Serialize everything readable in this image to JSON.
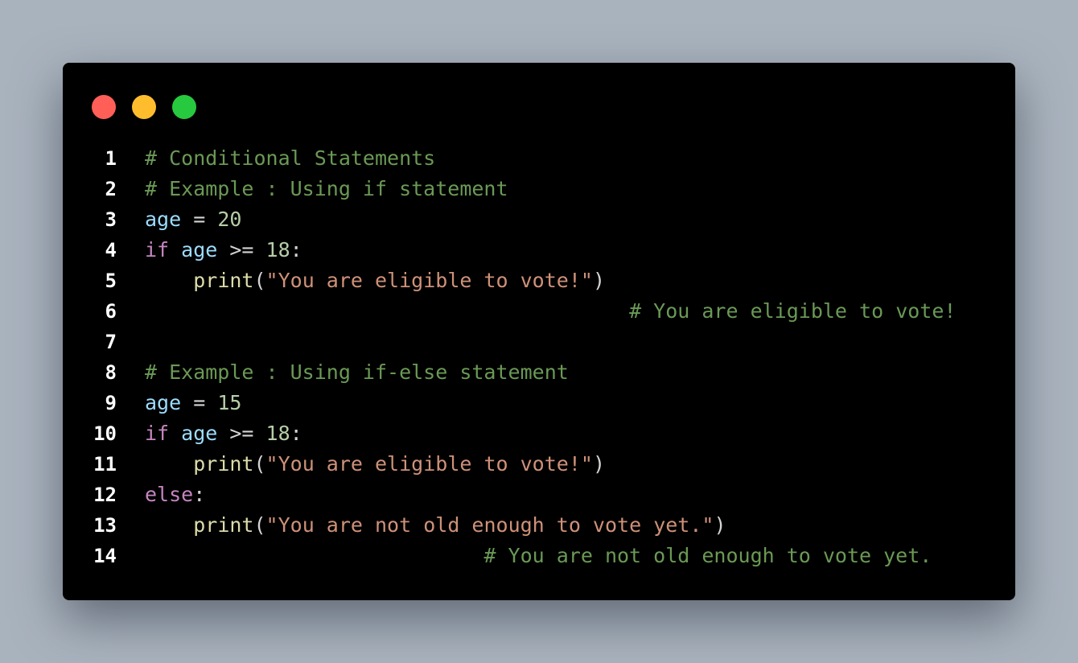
{
  "colors": {
    "background": "#a9b3be",
    "window": "#000000",
    "dot_red": "#ff5f56",
    "dot_yellow": "#ffbd2e",
    "dot_green": "#27c93f",
    "line_number": "#ffffff",
    "comment": "#6a9955",
    "variable": "#9cdcfe",
    "number": "#b5cea8",
    "keyword": "#c586c0",
    "function": "#dcdcaa",
    "string": "#ce9178",
    "operator": "#d4d4d4"
  },
  "window_controls": [
    {
      "name": "close-dot",
      "color": "#ff5f56"
    },
    {
      "name": "minimize-dot",
      "color": "#ffbd2e"
    },
    {
      "name": "maximize-dot",
      "color": "#27c93f"
    }
  ],
  "lines": [
    {
      "number": "1",
      "tokens": [
        {
          "t": "comment",
          "v": "# Conditional Statements"
        }
      ]
    },
    {
      "number": "2",
      "tokens": [
        {
          "t": "comment",
          "v": "# Example : Using if statement"
        }
      ]
    },
    {
      "number": "3",
      "tokens": [
        {
          "t": "var",
          "v": "age"
        },
        {
          "t": "op",
          "v": " = "
        },
        {
          "t": "num",
          "v": "20"
        }
      ]
    },
    {
      "number": "4",
      "tokens": [
        {
          "t": "kw",
          "v": "if"
        },
        {
          "t": "op",
          "v": " "
        },
        {
          "t": "var",
          "v": "age"
        },
        {
          "t": "op",
          "v": " >= "
        },
        {
          "t": "num",
          "v": "18"
        },
        {
          "t": "punc",
          "v": ":"
        }
      ]
    },
    {
      "number": "5",
      "tokens": [
        {
          "t": "op",
          "v": "    "
        },
        {
          "t": "fn",
          "v": "print"
        },
        {
          "t": "punc",
          "v": "("
        },
        {
          "t": "str",
          "v": "\"You are eligible to vote!\""
        },
        {
          "t": "punc",
          "v": ")"
        }
      ]
    },
    {
      "number": "6",
      "tokens": [
        {
          "t": "op",
          "v": "                                        "
        },
        {
          "t": "comment",
          "v": "# You are eligible to vote!"
        }
      ]
    },
    {
      "number": "7",
      "tokens": []
    },
    {
      "number": "8",
      "tokens": [
        {
          "t": "comment",
          "v": "# Example : Using if-else statement"
        }
      ]
    },
    {
      "number": "9",
      "tokens": [
        {
          "t": "var",
          "v": "age"
        },
        {
          "t": "op",
          "v": " = "
        },
        {
          "t": "num",
          "v": "15"
        }
      ]
    },
    {
      "number": "10",
      "tokens": [
        {
          "t": "kw",
          "v": "if"
        },
        {
          "t": "op",
          "v": " "
        },
        {
          "t": "var",
          "v": "age"
        },
        {
          "t": "op",
          "v": " >= "
        },
        {
          "t": "num",
          "v": "18"
        },
        {
          "t": "punc",
          "v": ":"
        }
      ]
    },
    {
      "number": "11",
      "tokens": [
        {
          "t": "op",
          "v": "    "
        },
        {
          "t": "fn",
          "v": "print"
        },
        {
          "t": "punc",
          "v": "("
        },
        {
          "t": "str",
          "v": "\"You are eligible to vote!\""
        },
        {
          "t": "punc",
          "v": ")"
        }
      ]
    },
    {
      "number": "12",
      "tokens": [
        {
          "t": "kw",
          "v": "else"
        },
        {
          "t": "punc",
          "v": ":"
        }
      ]
    },
    {
      "number": "13",
      "tokens": [
        {
          "t": "op",
          "v": "    "
        },
        {
          "t": "fn",
          "v": "print"
        },
        {
          "t": "punc",
          "v": "("
        },
        {
          "t": "str",
          "v": "\"You are not old enough to vote yet.\""
        },
        {
          "t": "punc",
          "v": ")"
        }
      ]
    },
    {
      "number": "14",
      "tokens": [
        {
          "t": "op",
          "v": "                            "
        },
        {
          "t": "comment",
          "v": "# You are not old enough to vote yet."
        }
      ]
    }
  ]
}
